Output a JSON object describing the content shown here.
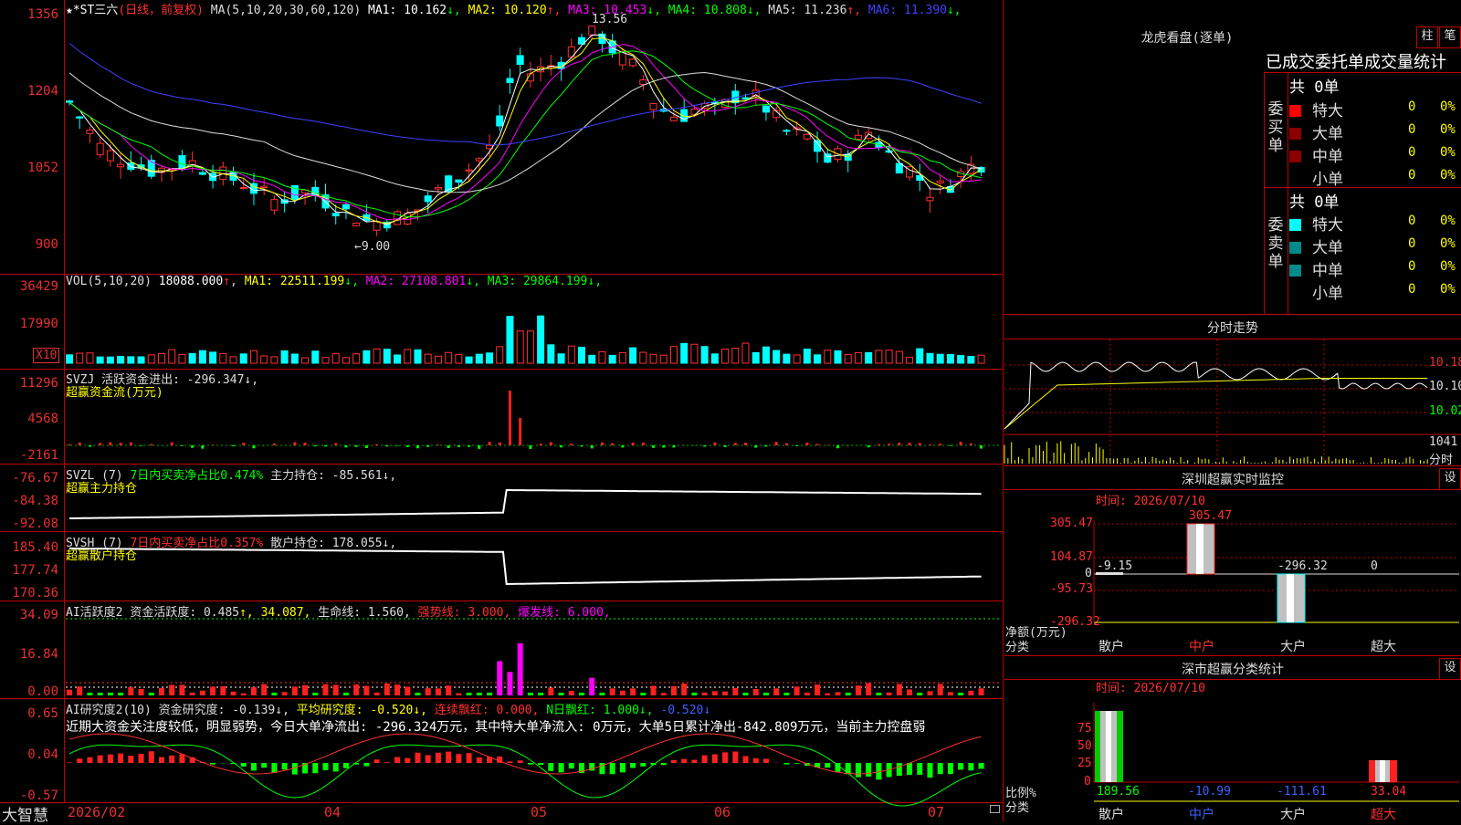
{
  "main": {
    "header": {
      "title": "★*ST三六",
      "mode": "(日线，前复权)",
      "ma_spec": "MA(5,10,20,30,60,120)",
      "items": [
        {
          "label": "MA1:",
          "value": "10.162",
          "arrow": "↓",
          "color": "#ffffff"
        },
        {
          "label": "MA2:",
          "value": "10.120",
          "arrow": "↑",
          "color": "#ffff00"
        },
        {
          "label": "MA3:",
          "value": "10.453",
          "arrow": "↓",
          "color": "#ff00ff"
        },
        {
          "label": "MA4:",
          "value": "10.808",
          "arrow": "↓",
          "color": "#00ff00"
        },
        {
          "label": "MA5:",
          "value": "11.236",
          "arrow": "↑",
          "color": "#dddddd"
        },
        {
          "label": "MA6:",
          "value": "11.390",
          "arrow": "↓",
          "color": "#4040ff"
        }
      ]
    },
    "y_labels": [
      "1356",
      "1204",
      "1052",
      "900"
    ],
    "high_marker": "13.56",
    "low_marker": "←9.00"
  },
  "vol": {
    "header": {
      "spec": "VOL(5,10,20)",
      "value": "18088.000",
      "arrow": "↑",
      "items": [
        {
          "label": "MA1:",
          "value": "22511.199",
          "arrow": "↓",
          "color": "#ffff00"
        },
        {
          "label": "MA2:",
          "value": "27108.801",
          "arrow": "↓",
          "color": "#ff00ff"
        },
        {
          "label": "MA3:",
          "value": "29864.199",
          "arrow": "↓",
          "color": "#00ff00"
        }
      ]
    },
    "y_labels": [
      "36429",
      "17990"
    ],
    "unit": "X10"
  },
  "svzj": {
    "header": "SVZJ  活跃资金进出: -296.347↓,",
    "sub": "超赢资金流(万元)",
    "y_labels": [
      "11296",
      "4568",
      "-2161"
    ]
  },
  "svzl": {
    "header_a": "SVZL (7)",
    "header_b": "7日内买卖净占比0.474%",
    "header_c": "主力持仓: -85.561↓,",
    "sub": "超赢主力持仓",
    "y_labels": [
      "-76.67",
      "-84.38",
      "-92.08"
    ]
  },
  "svsh": {
    "header_a": "SVSH (7)",
    "header_b": "7日内买卖净占比0.357%",
    "header_c": "散户持仓: 178.055↓,",
    "sub": "超赢散户持仓",
    "y_labels": [
      "185.40",
      "177.74",
      "170.36"
    ]
  },
  "ai1": {
    "header_a": "AI活跃度2",
    "header_b": "资金活跃度: 0.485",
    "header_c": "↑, 34.087,",
    "header_d": "生命线: 1.560,",
    "header_e": "强势线: 3.000,",
    "header_f": "爆发线: 6.000,",
    "y_labels": [
      "34.09",
      "16.84",
      "0.00"
    ]
  },
  "ai2": {
    "header_a": "AI研究度2(10)",
    "header_b": "资金研究度: -0.139↓,",
    "header_c": "平均研究度: -0.520↓,",
    "header_d": "连续飘红: 0.000,",
    "header_e": "N日飘红: 1.000↓,",
    "header_f": "-0.520↓",
    "comment": "近期大资金关注度较低，明显弱势，今日大单净流出: -296.324万元，其中特大单净流入: 0万元，大单5日累计净出-842.809万元，当前主力控盘弱",
    "y_labels": [
      "0.65",
      "0.04",
      "-0.57"
    ]
  },
  "xaxis": {
    "brand": "大智慧",
    "labels": [
      "2026/02",
      "04",
      "05",
      "06",
      "07"
    ]
  },
  "dragon": {
    "title": "龙虎看盘(逐单)",
    "btn_bar": "柱",
    "btn_pen": "笔",
    "tabs": "已成交委托单成交量统计",
    "buy_label": "委买单",
    "sell_label": "委卖单",
    "buy_total": "共 0单",
    "sell_total": "共 0单",
    "rows": [
      {
        "name": "特大",
        "val": "0",
        "pct": "0%"
      },
      {
        "name": "大单",
        "val": "0",
        "pct": "0%"
      },
      {
        "name": "中单",
        "val": "0",
        "pct": "0%"
      },
      {
        "name": "小单",
        "val": "0",
        "pct": "0%"
      }
    ]
  },
  "intraday": {
    "title": "分时走势",
    "y_labels": [
      "10.18",
      "10.10",
      "10.02",
      "1041",
      "分时"
    ]
  },
  "sz_monitor": {
    "title": "深圳超赢实时监控",
    "btn": "设",
    "date": "时间: 2026/07/10",
    "y_labels": [
      "305.47",
      "104.87",
      "0",
      "-95.73",
      "-296.32"
    ],
    "values": [
      "-9.15",
      "305.47",
      "-296.32",
      "0"
    ],
    "y_unit_a": "净额(万元)",
    "y_unit_b": "分类",
    "cats": [
      "散户",
      "中户",
      "大户",
      "超大"
    ]
  },
  "sz_class": {
    "title": "深市超赢分类统计",
    "btn": "设",
    "date": "时间: 2026/07/10",
    "y_labels": [
      "75",
      "50",
      "25",
      "0"
    ],
    "values": [
      "189.56",
      "-10.99",
      "-111.61",
      "33.04"
    ],
    "y_unit_a": "比例%",
    "y_unit_b": "分类",
    "cats": [
      "散户",
      "中户",
      "大户",
      "超大"
    ]
  },
  "colors": {
    "up": "#ff3030",
    "down": "#00ffff",
    "border": "#c00000",
    "label": "#e83030"
  }
}
